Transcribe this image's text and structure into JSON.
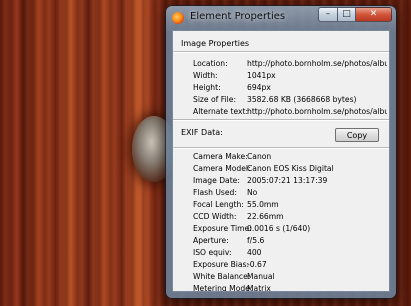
{
  "window": {
    "title": "Element Properties",
    "caption_buttons": {
      "minimize": "–",
      "maximize": "□",
      "close": "✕"
    }
  },
  "image_properties": {
    "heading": "Image Properties",
    "rows": [
      {
        "label": "Location:",
        "value": "http://photo.bornholm.se/photos/albuml"
      },
      {
        "label": "Width:",
        "value": "1041px"
      },
      {
        "label": "Height:",
        "value": "694px"
      },
      {
        "label": "Size of File:",
        "value": "3582.68 KB (3668668 bytes)"
      },
      {
        "label": "Alternate text:",
        "value": "http://photo.bornholm.se/photos/albuml"
      }
    ]
  },
  "exif": {
    "heading": "EXIF Data:",
    "copy_label": "Copy",
    "rows": [
      {
        "label": "Camera Make:",
        "value": "Canon"
      },
      {
        "label": "Camera Model:",
        "value": "Canon EOS Kiss Digital"
      },
      {
        "label": "Image Date:",
        "value": "2005:07:21 13:17:39"
      },
      {
        "label": "Flash Used:",
        "value": "No"
      },
      {
        "label": "Focal Length:",
        "value": "55.0mm"
      },
      {
        "label": "CCD Width:",
        "value": "22.66mm"
      },
      {
        "label": "Exposure Time:",
        "value": "0.0016 s (1/640)"
      },
      {
        "label": "Aperture:",
        "value": "f/5.6"
      },
      {
        "label": "ISO equiv:",
        "value": "400"
      },
      {
        "label": "Exposure Bias:",
        "value": "-0.67"
      },
      {
        "label": "White Balance:",
        "value": "Manual"
      },
      {
        "label": "Metering Mode:",
        "value": "Matrix"
      }
    ]
  },
  "icons": {
    "app": "firefox-icon"
  }
}
